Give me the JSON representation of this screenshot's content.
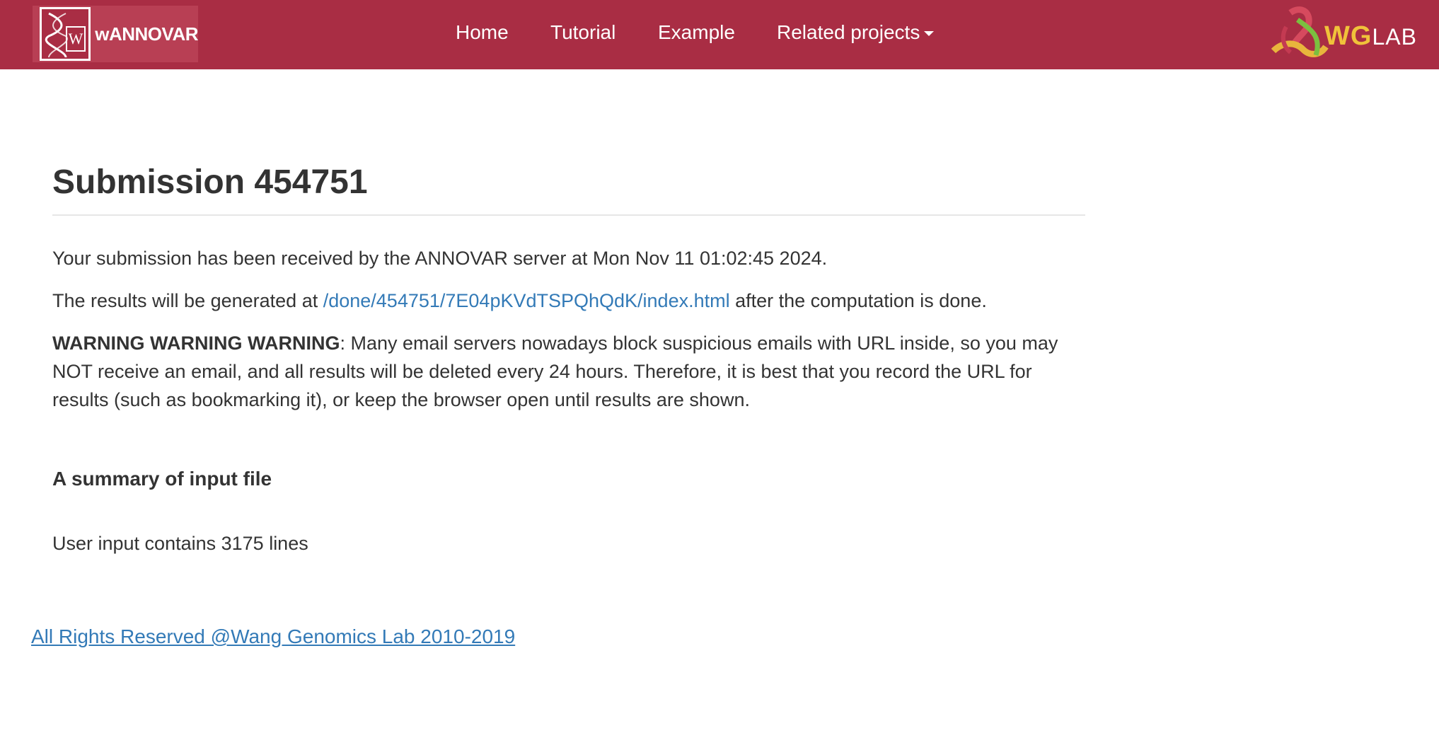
{
  "navbar": {
    "brand_text": "wANNOVAR",
    "brand_logo_letter": "W",
    "items": [
      {
        "label": "Home"
      },
      {
        "label": "Tutorial"
      },
      {
        "label": "Example"
      },
      {
        "label": "Related projects"
      }
    ],
    "partner_logo": {
      "strong": "WG",
      "rest": "LAB"
    },
    "background": "#a92d44"
  },
  "main": {
    "title": "Submission 454751",
    "received": "Your submission has been received by the ANNOVAR server at Mon Nov 11 01:02:45 2024.",
    "results_prefix": "The results will be generated at ",
    "results_link": "/done/454751/7E04pKVdTSPQhQdK/index.html",
    "results_suffix": " after the computation is done.",
    "warning_bold": "WARNING WARNING WARNING",
    "warning_text": ": Many email servers nowadays block suspicious emails with URL inside, so you may NOT receive an email, and all results will be deleted every 24 hours. Therefore, it is best that you record the URL for results (such as bookmarking it), or keep the browser open until results are shown.",
    "summary_heading": "A summary of input file",
    "summary_text": "User input contains 3175 lines"
  },
  "footer": {
    "text": "All Rights Reserved @Wang Genomics Lab 2010-2019"
  },
  "colors": {
    "link": "#337ab7",
    "text": "#333333",
    "accent": "#a92d44"
  }
}
